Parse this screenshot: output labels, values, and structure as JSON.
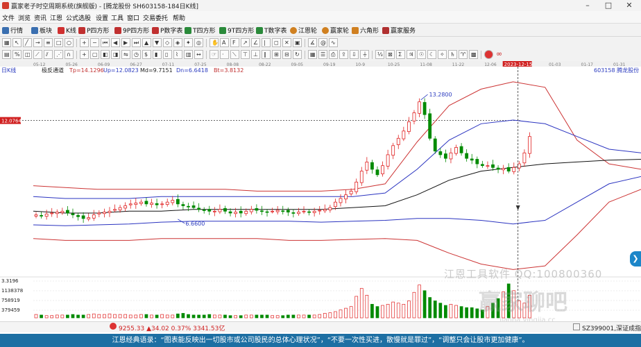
{
  "window": {
    "title": "赢家老子时空周期系统(旗舰版) - [腾龙股份  SH603158-184日K线]"
  },
  "menu": [
    "文件",
    "浏览",
    "资讯",
    "江恩",
    "公式选股",
    "设置",
    "工具",
    "窗口",
    "交易委托",
    "帮助"
  ],
  "toolbar1": [
    {
      "label": "行情",
      "color": "#3a6fb0"
    },
    {
      "label": "板块",
      "color": "#3a6fb0"
    },
    {
      "label": "K线",
      "color": "#d03030"
    },
    {
      "label": "P四方形",
      "color": "#c03030"
    },
    {
      "label": "9P四方形",
      "color": "#c03030"
    },
    {
      "label": "P数字表",
      "color": "#c03030"
    },
    {
      "label": "T四方形",
      "color": "#2a8a3a"
    },
    {
      "label": "9T四方形",
      "color": "#2a8a3a"
    },
    {
      "label": "T数字表",
      "color": "#2a8a3a"
    },
    {
      "label": "江恩轮",
      "color": "#d08020"
    },
    {
      "label": "赢家轮",
      "color": "#d08020"
    },
    {
      "label": "六角形",
      "color": "#d08020"
    },
    {
      "label": "赢家服务",
      "color": "#b03030"
    }
  ],
  "chart_header": {
    "period": "日K线",
    "indicator": "极反通道",
    "tp": "Tp=14.1296",
    "up": "Up=12.0823",
    "md": "Md=9.7151",
    "dn": "Dn=6.6418",
    "bt": "Bt=3.8132",
    "stock": "603158  腾龙股份"
  },
  "date_labels": [
    "05-12",
    "05-26",
    "06-09",
    "06-27",
    "07-11",
    "07-25",
    "08-08",
    "08-22",
    "09-05",
    "09-19",
    "10-9",
    "10-25",
    "11-08",
    "11-22",
    "12-06",
    "2023-12-15",
    "01-03",
    "01-17",
    "01-31"
  ],
  "price_marker": "12.0764",
  "annotations": {
    "high": "13.2800",
    "low": "6.6600"
  },
  "volume_axis": [
    "3.3196",
    "1138378",
    "758919",
    "379459"
  ],
  "status": {
    "index1": "9255.33",
    "index1_change": "34.02",
    "index1_pct": "0.37%",
    "index1_amount": "3341.53亿",
    "index2": "SZ399001,深证成指"
  },
  "watermark": {
    "line1": "江恩工具软件  QQ:100800360",
    "line2": "赢家聊吧",
    "line3": "jiaoba.yingjia.cc"
  },
  "footer": "江恩经典语录：“图表能反映出一切股市或公司股民的总体心理状况”，“不要一次性买进，散慢就是罪过”，“调整只会让股市更加健康”。",
  "colors": {
    "up": "#e02020",
    "down": "#008a00",
    "outer_band": "#cc3333",
    "inner_band": "#2a33c0",
    "mid_line": "#111111",
    "accent": "#1d6fa3"
  },
  "chart_data": {
    "type": "candlestick",
    "title": "",
    "ylabel": "",
    "ylim": [
      3.8,
      14.5
    ],
    "note_high": 13.28,
    "note_low": 6.66,
    "x_labels": [
      "05-12",
      "05-26",
      "06-09",
      "06-27",
      "07-11",
      "07-25",
      "08-08",
      "08-22",
      "09-05",
      "09-19",
      "10-9",
      "10-25",
      "11-08",
      "11-22",
      "12-06",
      "2023-12-15",
      "01-03",
      "01-17",
      "01-31"
    ],
    "bands": {
      "tp": [
        8.5,
        8.4,
        8.3,
        8.3,
        8.3,
        8.3,
        8.3,
        8.2,
        8.2,
        8.2,
        8.3,
        8.6,
        10.9,
        12.9,
        13.8,
        14.2,
        13.9,
        11.0,
        9.7,
        9.4
      ],
      "up": [
        7.9,
        7.8,
        7.8,
        7.8,
        7.9,
        7.9,
        7.9,
        7.9,
        7.9,
        7.9,
        7.9,
        8.1,
        9.4,
        11.0,
        11.9,
        12.1,
        11.9,
        11.2,
        10.5,
        10.3
      ],
      "md": [
        7.1,
        7.0,
        7.0,
        7.1,
        7.1,
        7.2,
        7.2,
        7.2,
        7.2,
        7.2,
        7.3,
        7.4,
        8.0,
        8.8,
        9.3,
        9.5,
        9.7,
        9.8,
        9.9,
        9.95
      ],
      "dn": [
        6.35,
        6.3,
        6.35,
        6.4,
        6.5,
        6.55,
        6.55,
        6.55,
        6.55,
        6.5,
        6.55,
        6.6,
        6.7,
        6.7,
        6.6,
        6.4,
        6.6,
        7.6,
        8.6,
        9.0
      ],
      "bt": [
        5.6,
        5.5,
        5.5,
        5.5,
        5.6,
        5.6,
        5.6,
        5.6,
        5.5,
        5.5,
        5.55,
        5.6,
        5.5,
        4.8,
        4.2,
        3.9,
        4.1,
        5.8,
        7.6,
        8.3
      ]
    },
    "closes": [
      6.9,
      6.85,
      6.95,
      7.0,
      7.05,
      7.1,
      7.0,
      6.9,
      6.8,
      6.7,
      6.75,
      6.9,
      7.0,
      7.05,
      7.1,
      7.2,
      7.3,
      7.4,
      7.5,
      7.55,
      7.6,
      7.5,
      7.55,
      7.45,
      7.5,
      7.6,
      7.7,
      7.5,
      7.4,
      7.35,
      7.3,
      7.2,
      7.15,
      7.1,
      7.1,
      7.2,
      7.1,
      7.0,
      7.05,
      7.0,
      7.1,
      7.2,
      7.15,
      7.1,
      7.05,
      7.1,
      7.15,
      7.1,
      7.05,
      7.0,
      7.05,
      7.1,
      7.05,
      7.1,
      7.15,
      7.2,
      7.3,
      7.6,
      7.8,
      8.0,
      8.2,
      8.7,
      9.3,
      9.8,
      9.4,
      9.1,
      9.6,
      10.2,
      10.7,
      11.1,
      11.5,
      12.0,
      12.5,
      13.1,
      12.4,
      11.1,
      10.4,
      10.2,
      10.0,
      10.3,
      10.6,
      10.3,
      10.0,
      9.9,
      9.7,
      9.6,
      9.6,
      9.5,
      9.4,
      9.45,
      9.3,
      9.5,
      9.7,
      10.3,
      11.2
    ],
    "volumes": [
      6,
      5,
      4,
      4,
      5,
      5,
      5,
      6,
      5,
      5,
      6,
      7,
      6,
      6,
      7,
      6,
      6,
      6,
      5,
      5,
      6,
      6,
      5,
      5,
      6,
      5,
      5,
      7,
      8,
      6,
      5,
      5,
      5,
      6,
      5,
      5,
      5,
      4,
      4,
      4,
      5,
      5,
      5,
      5,
      5,
      4,
      4,
      4,
      5,
      5,
      5,
      5,
      5,
      5,
      6,
      8,
      9,
      11,
      14,
      17,
      20,
      38,
      52,
      40,
      24,
      20,
      22,
      24,
      28,
      26,
      24,
      30,
      45,
      58,
      48,
      36,
      30,
      26,
      22,
      24,
      22,
      20,
      18,
      18,
      16,
      14,
      20,
      26,
      34,
      46,
      60,
      48,
      30,
      26,
      40
    ]
  }
}
